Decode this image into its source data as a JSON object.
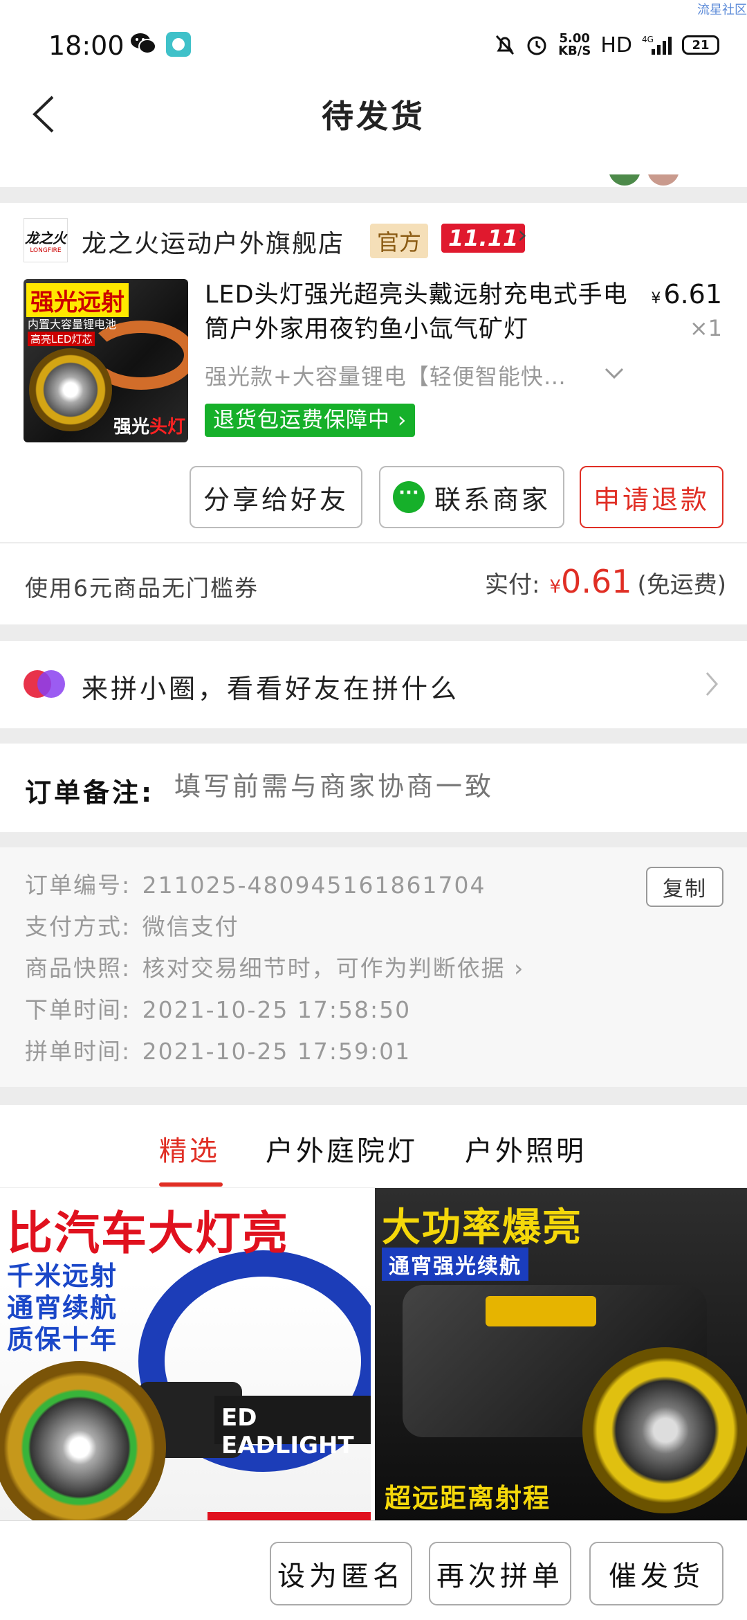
{
  "status_bar": {
    "time": "18:00",
    "net_speed_value": "5.00",
    "net_speed_unit": "KB/S",
    "hd": "HD",
    "network": "4G",
    "battery": "21",
    "watermark": "流星社区"
  },
  "header": {
    "title": "待发货"
  },
  "order": {
    "shop_logo_text": "龙之火",
    "shop_logo_sub": "LONGFIRE",
    "shop_name": "龙之火运动户外旗舰店",
    "badge_official": "官方",
    "badge_1111": "11.11",
    "product_image_text": {
      "t1": "强光远射",
      "t2": "内置大容量锂电池",
      "t3": "高亮LED灯芯",
      "t4a": "强光",
      "t4b": "头灯"
    },
    "product_title": "LED头灯强光超亮头戴远射充电式手电筒户外家用夜钓鱼小氙气矿灯",
    "price_symbol": "¥",
    "price": "6.61",
    "quantity": "×1",
    "spec": "强光款+大容量锂电【轻便智能快…",
    "return_badge": "退货包运费保障中",
    "buttons": {
      "share": "分享给好友",
      "contact": "联系商家",
      "refund": "申请退款"
    }
  },
  "payment": {
    "coupon": "使用6元商品无门槛券",
    "paid_label": "实付:",
    "currency": "¥",
    "amount": "0.61",
    "shipping_note": "(免运费)"
  },
  "pin_circle": {
    "text": "来拼小圈，看看好友在拼什么"
  },
  "remark": {
    "label": "订单备注:",
    "placeholder": "填写前需与商家协商一致"
  },
  "info": {
    "copy_label": "复制",
    "rows": [
      {
        "label": "订单编号:",
        "value": "211025-480945161861704"
      },
      {
        "label": "支付方式:",
        "value": "微信支付"
      },
      {
        "label": "商品快照:",
        "value": "核对交易细节时，可作为判断依据 ›"
      },
      {
        "label": "下单时间:",
        "value": "2021-10-25 17:58:50"
      },
      {
        "label": "拼单时间:",
        "value": "2021-10-25 17:59:01"
      }
    ]
  },
  "tabs": [
    "精选",
    "户外庭院灯",
    "户外照明"
  ],
  "recommendations": {
    "left": {
      "headline": "比汽车大灯亮",
      "line1": "千米远射",
      "line2": "通宵续航",
      "line3": "质保十年",
      "band": "ED EADLIGHT"
    },
    "right": {
      "headline": "大功率爆亮",
      "sub": "通宵强光续航",
      "bottom": "超远距离射程"
    }
  },
  "bottom_bar": {
    "anonymous": "设为匿名",
    "reorder": "再次拼单",
    "urge": "催发货"
  },
  "colors": {
    "accent_red": "#e02e24",
    "green": "#16b02a",
    "official_bg": "#f5dfb8",
    "badge_1111_bg": "#e0192e"
  }
}
